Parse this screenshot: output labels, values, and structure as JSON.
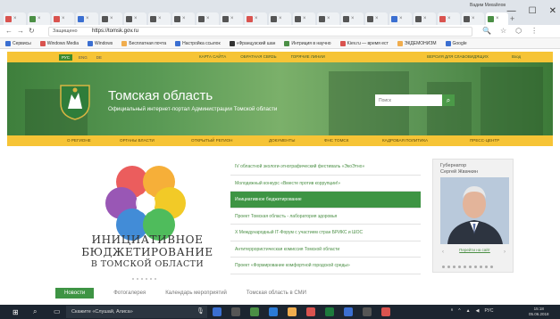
{
  "browser": {
    "user_name": "Вадим Михайлов",
    "controls": [
      "—",
      "☐",
      "✕"
    ],
    "tab_colors": [
      "#d9534f",
      "#4b8f45",
      "#d9534f",
      "#3b6fd1",
      "#555",
      "#555",
      "#555",
      "#555",
      "#555",
      "#555",
      "#d9534f",
      "#555",
      "#555",
      "#555",
      "#555",
      "#555",
      "#3b6fd1",
      "#555",
      "#d9534f",
      "#555",
      "#4b8f45"
    ],
    "address": {
      "secure_label": "Защищено",
      "url": "https://tomsk.gov.ru"
    },
    "bookmarks": [
      {
        "label": "Сервисы",
        "color": "#3b6fd1"
      },
      {
        "label": "Windows Media",
        "color": "#d9534f"
      },
      {
        "label": "Windows",
        "color": "#3b6fd1"
      },
      {
        "label": "Бесплатная почта",
        "color": "#f0ad4e"
      },
      {
        "label": "Настройка ссылок",
        "color": "#3b6fd1"
      },
      {
        "label": "«Французский шан",
        "color": "#333"
      },
      {
        "label": "Интриция в научно",
        "color": "#4b8f45"
      },
      {
        "label": "Kiev.ru — время ест",
        "color": "#d9534f"
      },
      {
        "label": "ЭКДЕМОНИЗМ",
        "color": "#f0ad4e"
      },
      {
        "label": "Google",
        "color": "#3b6fd1"
      }
    ]
  },
  "site": {
    "langs": [
      "РУС",
      "ENG",
      "DE"
    ],
    "top_links": [
      "КАРТА САЙТА",
      "ОБРАТНАЯ СВЯЗЬ",
      "ГОРЯЧИЕ ЛИНИИ"
    ],
    "blind_version": "ВЕРСИЯ ДЛЯ СЛАБОВИДЯЩИХ",
    "login": "Вход",
    "title": "Томская область",
    "subtitle": "Официальный интернет-портал Администрации Томской области",
    "search_placeholder": "Поиск",
    "menu": [
      "О РЕГИОНЕ",
      "ОРГАНЫ ВЛАСТИ",
      "ОТКРЫТЫЙ РЕГИОН",
      "ДОКУМЕНТЫ",
      "ФНС ТОМСК",
      "КАДРОВАЯ ПОЛИТИКА",
      "ПРЕСС-ЦЕНТР"
    ],
    "campaign": [
      "ИНИЦИАТИВНОЕ",
      "БЮДЖЕТИРОВАНИЕ",
      "В ТОМСКОЙ ОБЛАСТИ"
    ],
    "news": [
      "IV областной экологи-этнографический фестиваль «ЭкоЭтно»",
      "Молодежный конкурс «Вместе против коррупции!»",
      "Инициативное бюджетирование",
      "Проект Томская область - лаборатория здоровья",
      "X Международный IT-Форум с участием стран БРИКС и ШОС",
      "Антитеррористическая комиссия Томской области",
      "Проект «Формирование комфортной городской среды»"
    ],
    "active_news_index": 2,
    "governor": {
      "title": "Губернатор",
      "name": "Сергей Жвачкин",
      "link": "Перейти на сайт"
    },
    "bottom_tabs": [
      "Новости",
      "Фотогалерея",
      "Календарь мероприятий",
      "Томская область в СМИ"
    ]
  },
  "taskbar": {
    "search_text": "Скажите «Слушай, Алиса»",
    "app_colors": [
      "#3b6fd1",
      "#555",
      "#4b8f45",
      "#2b7bd6",
      "#f0ad4e",
      "#d9534f",
      "#1c7a3c",
      "#3b6fd1",
      "#555",
      "#d9534f"
    ],
    "lang": "РУС",
    "time": "15:18",
    "date": "05.06.2018"
  }
}
